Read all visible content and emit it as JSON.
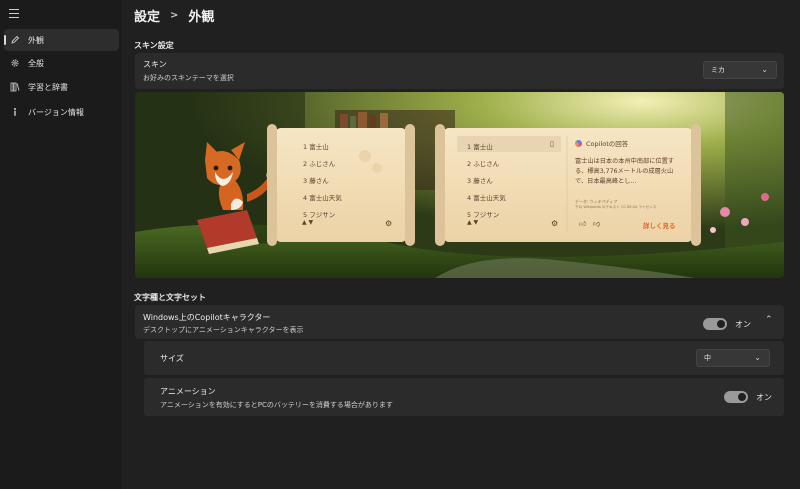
{
  "sidebar": {
    "menu_icon": "hamburger-icon",
    "items": [
      {
        "label": "外観",
        "icon": "pencil-icon",
        "active": true
      },
      {
        "label": "全般",
        "icon": "gear-icon",
        "active": false
      },
      {
        "label": "学習と辞書",
        "icon": "books-icon",
        "active": false
      },
      {
        "label": "バージョン情報",
        "icon": "info-icon",
        "active": false
      }
    ]
  },
  "header": {
    "breadcrumb_root": "設定",
    "separator": ">",
    "current_page": "外観"
  },
  "skin_section": {
    "heading": "スキン設定",
    "card": {
      "title": "スキン",
      "description": "お好みのスキンテーマを選択",
      "selected": "ミカ"
    }
  },
  "preview": {
    "left_panel": {
      "candidates": [
        "1  富士山",
        "2  ふじさん",
        "3  藤さん",
        "4  富士山天気",
        "5  フジサン"
      ]
    },
    "right_panel": {
      "candidates": [
        "1  富士山",
        "2  ふじさん",
        "3  藤さん",
        "4  富士山天気",
        "5  フジサン"
      ],
      "copilot_title": "Copilotの回答",
      "answer": "富士山は日本の本州中南部に位置する、標高3,776メートルの成層火山で、日本最高峰とし…",
      "source": "データ: ウィキペディア",
      "license": "下の Wikipedia のテキスト CC BY-SA ライセンス",
      "more_link": "詳しく見る"
    }
  },
  "char_section": {
    "heading": "文字種と文字セット",
    "copilot_card": {
      "title": "Windows上のCopilotキャラクター",
      "description": "デスクトップにアニメーションキャラクターを表示",
      "toggle_state": "オン"
    },
    "size_row": {
      "label": "サイズ",
      "selected": "中"
    },
    "animation_row": {
      "title": "アニメーション",
      "description": "アニメーションを有効にするとPCのバッテリーを消費する場合があります",
      "toggle_state": "オン"
    }
  },
  "colors": {
    "toggle_on": "#9a9a9a",
    "accent_orange": "#e06a2a"
  }
}
